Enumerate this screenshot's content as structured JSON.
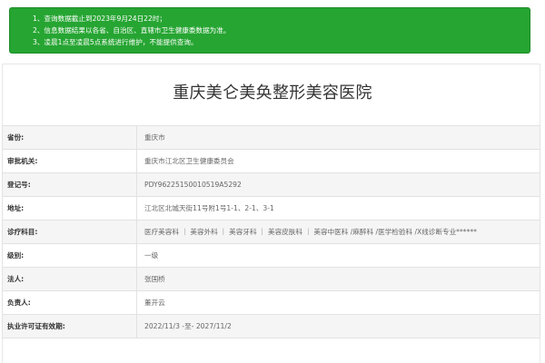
{
  "notice": {
    "lines": [
      "1、查询数据截止到2023年9月24日22时；",
      "2、信息数据结果以各省、自治区、直辖市卫生健康委数据为准。",
      "3、凌晨1点至凌晨5点系统进行维护，不能提供查询。"
    ]
  },
  "hospital": {
    "name": "重庆美仑美奂整形美容医院"
  },
  "rows": [
    {
      "label": "省份:",
      "value": "重庆市"
    },
    {
      "label": "审批机关:",
      "value": "重庆市江北区卫生健康委员会"
    },
    {
      "label": "登记号:",
      "value": "PDY96225150010519A5292"
    },
    {
      "label": "地址:",
      "value": "江北区北城天街11号附1号1-1、2-1、3-1"
    },
    {
      "label": "诊疗科目:",
      "value": "医疗美容科 ｜ 美容外科 ｜ 美容牙科 ｜ 美容皮肤科 ｜ 美容中医科 /麻醉科 /医学检验科 /X线诊断专业******"
    },
    {
      "label": "级别:",
      "value": "一级"
    },
    {
      "label": "法人:",
      "value": "张国桥"
    },
    {
      "label": "负责人:",
      "value": "董开云"
    },
    {
      "label": "执业许可证有效期:",
      "value": "2022/11/3 -至- 2027/11/2"
    }
  ]
}
